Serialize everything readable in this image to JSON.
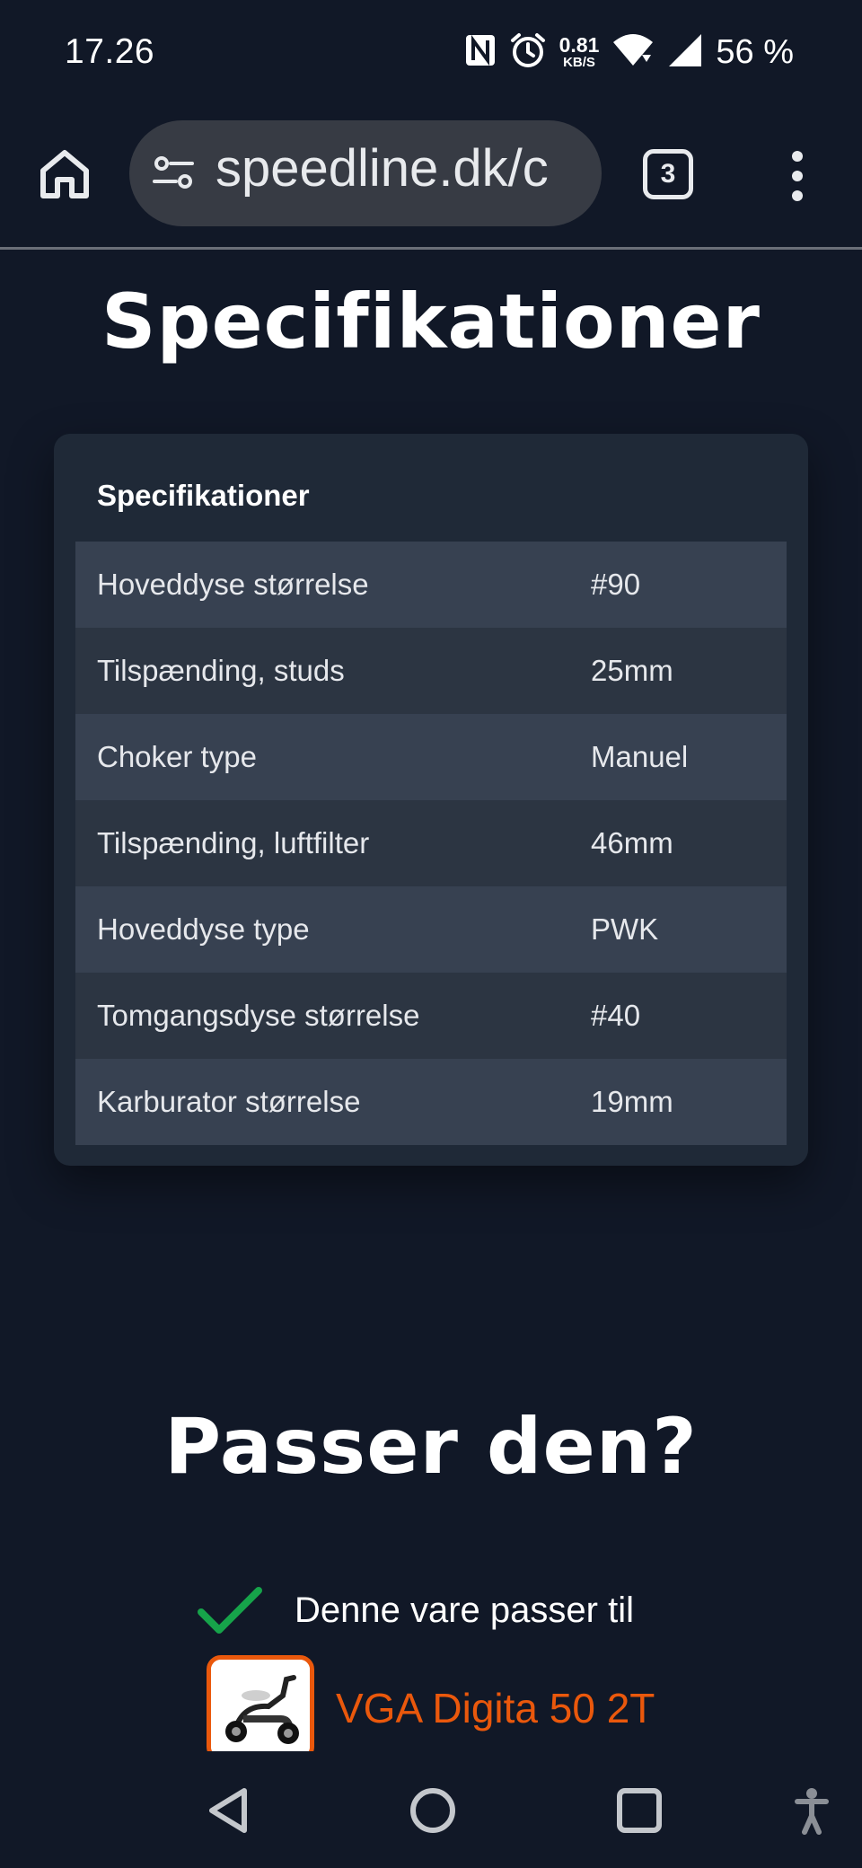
{
  "status_bar": {
    "time": "17.26",
    "net_speed_value": "0.81",
    "net_speed_unit": "KB/S",
    "battery": "56 %"
  },
  "browser": {
    "url": "speedline.dk/c",
    "tab_count": "3"
  },
  "page": {
    "spec_heading": "Specifikationer",
    "spec_card_title": "Specifikationer",
    "specs": [
      {
        "label": "Hoveddyse størrelse",
        "value": "#90"
      },
      {
        "label": "Tilspænding, studs",
        "value": "25mm"
      },
      {
        "label": "Choker type",
        "value": "Manuel"
      },
      {
        "label": "Tilspænding, luftfilter",
        "value": "46mm"
      },
      {
        "label": "Hoveddyse type",
        "value": "PWK"
      },
      {
        "label": "Tomgangsdyse størrelse",
        "value": "#40"
      },
      {
        "label": "Karburator størrelse",
        "value": "19mm"
      }
    ],
    "fit_heading": "Passer den?",
    "fit_text": "Denne vare passer til",
    "vehicle_name": "VGA Digita 50 2T"
  },
  "colors": {
    "background": "#111827",
    "card": "#1f2937",
    "accent_orange": "#ea580c",
    "check_green": "#16a34a"
  }
}
